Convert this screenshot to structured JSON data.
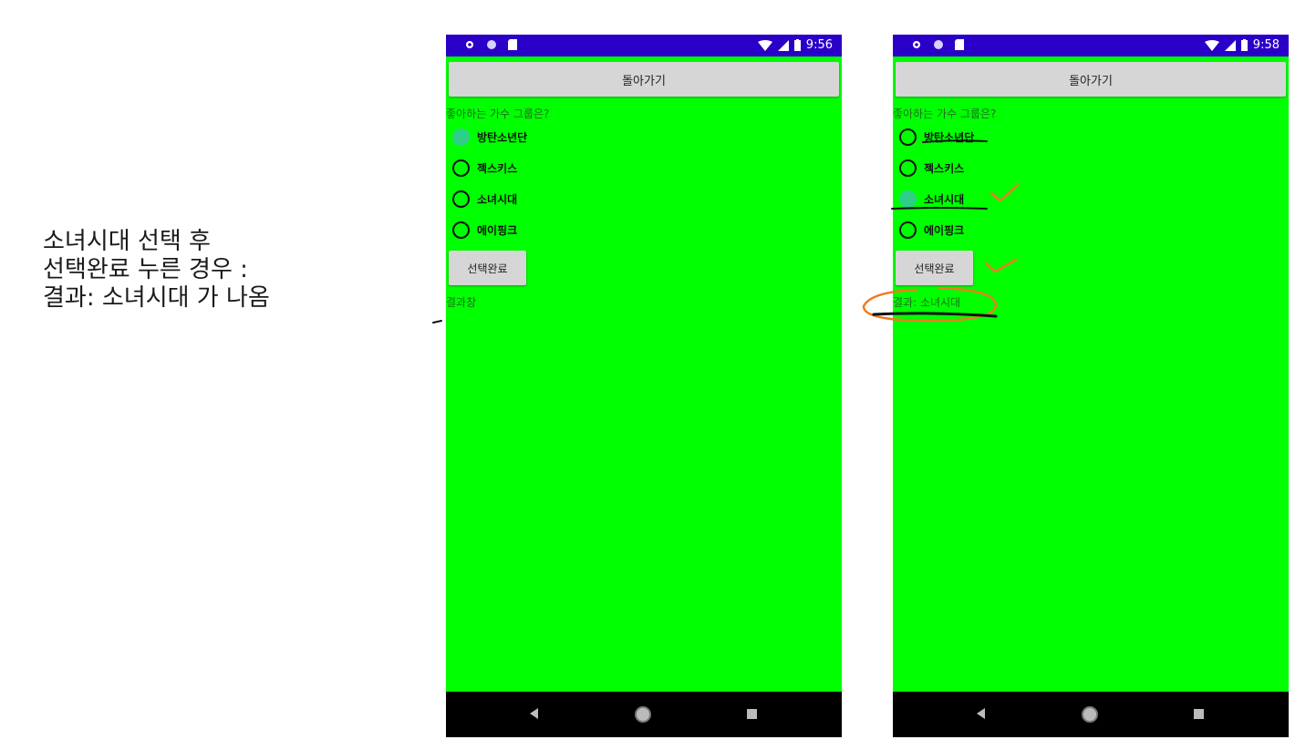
{
  "caption": {
    "text": "소녀시대 선택 후\n선택완료 누른 경우 :\n결과: 소녀시대 가 나옴"
  },
  "phone_left": {
    "status_time": "9:56",
    "back_button": "돌아가기",
    "question": "좋아하는 가수 그룹은?",
    "options": [
      "방탄소년단",
      "젝스키스",
      "소녀시대",
      "에이핑크"
    ],
    "selected_option": "방탄소년단",
    "submit_button": "선택완료",
    "result_text": "결과창"
  },
  "phone_right": {
    "status_time": "9:58",
    "back_button": "돌아가기",
    "question": "좋아하는 가수 그룹은?",
    "options": [
      "방탄소년단",
      "젝스키스",
      "소녀시대",
      "에이핑크"
    ],
    "selected_option": "소녀시대",
    "submit_button": "선택완료",
    "result_text": "결과: 소녀시대"
  },
  "colors": {
    "screen_background": "#00ff00",
    "status_bar": "#2a00c9",
    "radio_checked": "#35c6a0",
    "annotation_orange": "#f07a22",
    "annotation_black": "#111111"
  },
  "icons": [
    "settings-icon",
    "circle-status-icon",
    "sd-card-icon",
    "wifi-icon",
    "signal-icon",
    "battery-icon",
    "nav-back-icon",
    "nav-home-icon",
    "nav-recent-icon"
  ]
}
